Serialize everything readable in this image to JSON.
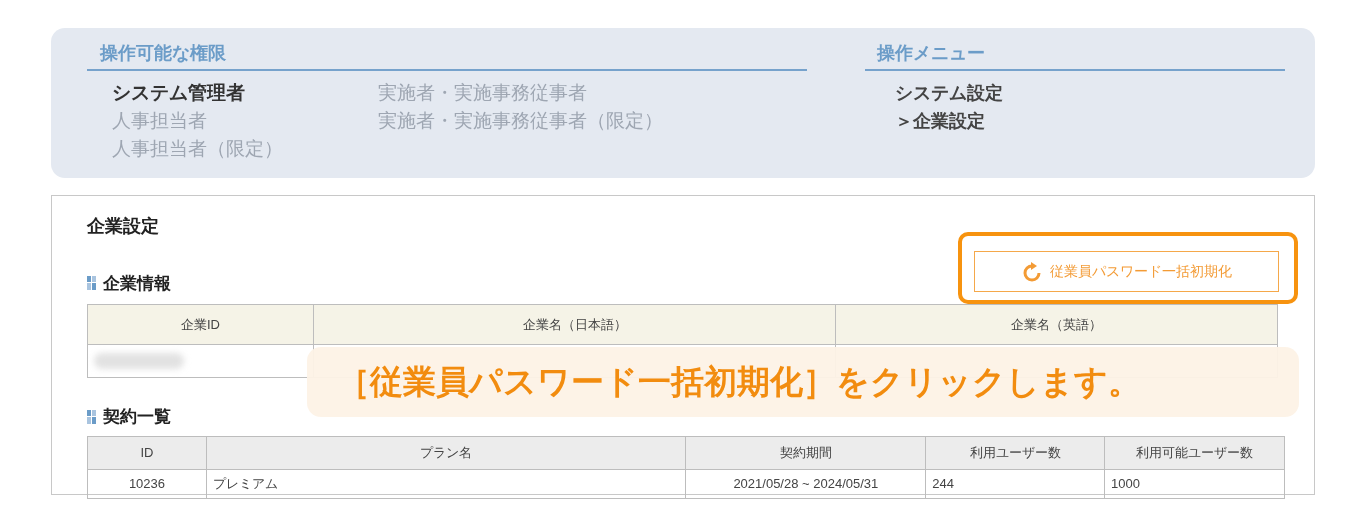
{
  "permissions": {
    "title": "操作可能な権限",
    "columns": [
      [
        {
          "label": "システム管理者",
          "active": true
        },
        {
          "label": "人事担当者",
          "active": false
        },
        {
          "label": "人事担当者（限定）",
          "active": false
        }
      ],
      [
        {
          "label": "実施者・実施事務従事者",
          "active": false
        },
        {
          "label": "実施者・実施事務従事者（限定）",
          "active": false
        }
      ]
    ]
  },
  "menu": {
    "title": "操作メニュー",
    "items": [
      {
        "label": "システム設定"
      },
      {
        "label": "＞企業設定"
      }
    ]
  },
  "page_title": "企業設定",
  "reset_button": {
    "label": "従業員パスワード一括初期化",
    "highlighted": true
  },
  "company_section": {
    "title": "企業情報",
    "columns": [
      "企業ID",
      "企業名（日本語）",
      "企業名（英語）"
    ],
    "rows": [
      {
        "cells": [
          {
            "kind": "redacted"
          },
          {
            "kind": "empty"
          },
          {
            "kind": "empty"
          }
        ]
      }
    ]
  },
  "contract_section": {
    "title": "契約一覧",
    "columns": [
      "ID",
      "プラン名",
      "契約期間",
      "利用ユーザー数",
      "利用可能ユーザー数"
    ],
    "rows": [
      [
        "10236",
        "プレミアム",
        "2021/05/28 ~ 2024/05/31",
        "244",
        "1000"
      ]
    ]
  },
  "callout": "［従業員パスワード一括初期化］をクリックします。"
}
